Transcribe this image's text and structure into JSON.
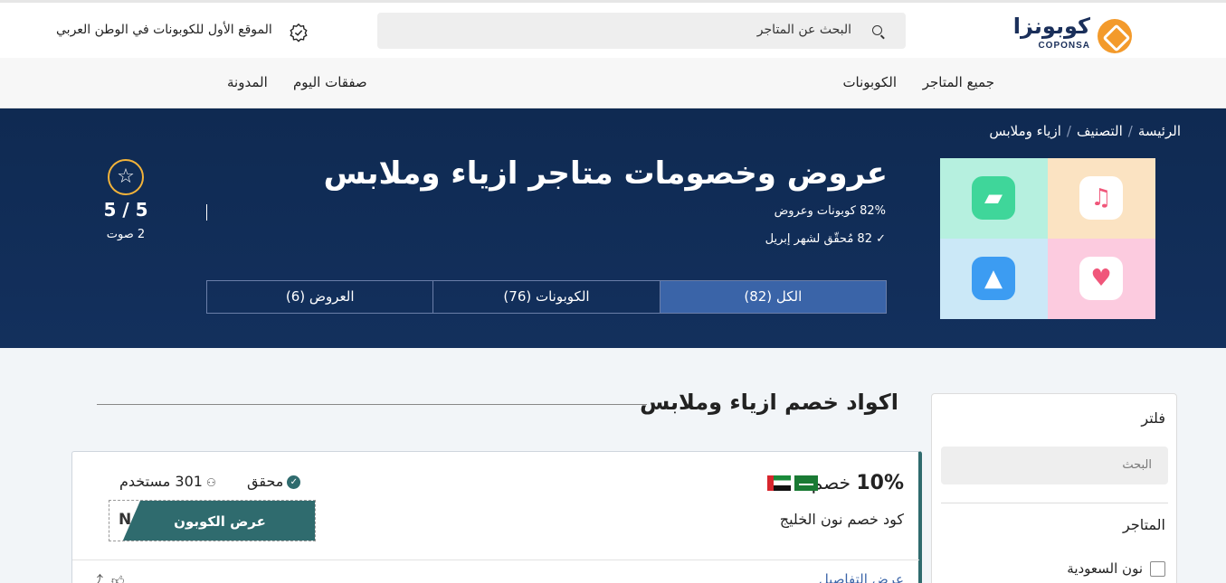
{
  "header": {
    "logo_ar": "كوبونزا",
    "logo_en": "COPONSA",
    "search_placeholder": "البحث عن المتاجر",
    "tagline": "الموقع الأول للكوبونات في الوطن العربي"
  },
  "nav": {
    "all_stores": "جميع المتاجر",
    "coupons": "الكوبونات",
    "today_deals": "صفقات اليوم",
    "blog": "المدونة"
  },
  "breadcrumb": {
    "home": "الرئيسة",
    "category": "التصنيف",
    "current": "ازياء وملابس"
  },
  "hero": {
    "title": "عروض وخصومات متاجر ازياء وملابس",
    "coupons_stat": "82% كوبونات وعروض",
    "verified_stat": "✓ 82 مُحقّق لشهر إبريل",
    "tabs": {
      "all": "الكل (82)",
      "coupons": "الكوبونات (76)",
      "offers": "العروض (6)"
    },
    "rating": {
      "value": "5 / 5",
      "votes": "2 صوت"
    }
  },
  "section": {
    "title": "اكواد خصم ازياء وملابس"
  },
  "coupon_card": {
    "discount": "10%",
    "discount_label": "خصم",
    "title": "كود خصم نون الخليج",
    "verified": "محقق",
    "users": "301 مستخدم",
    "code": "N",
    "show_button": "عرض الكوبون",
    "details": "عرض التفاصيل",
    "accent_color": "#2f6b6e"
  },
  "filter": {
    "title": "فلتر",
    "search_placeholder": "البحث",
    "stores_title": "المتاجر",
    "store_1": "نون السعودية"
  },
  "colors": {
    "hero_bg": "#13305d",
    "tab_active": "#3a64a8",
    "star_ring": "#f2b33a",
    "logo_orange": "#f39a2b"
  }
}
